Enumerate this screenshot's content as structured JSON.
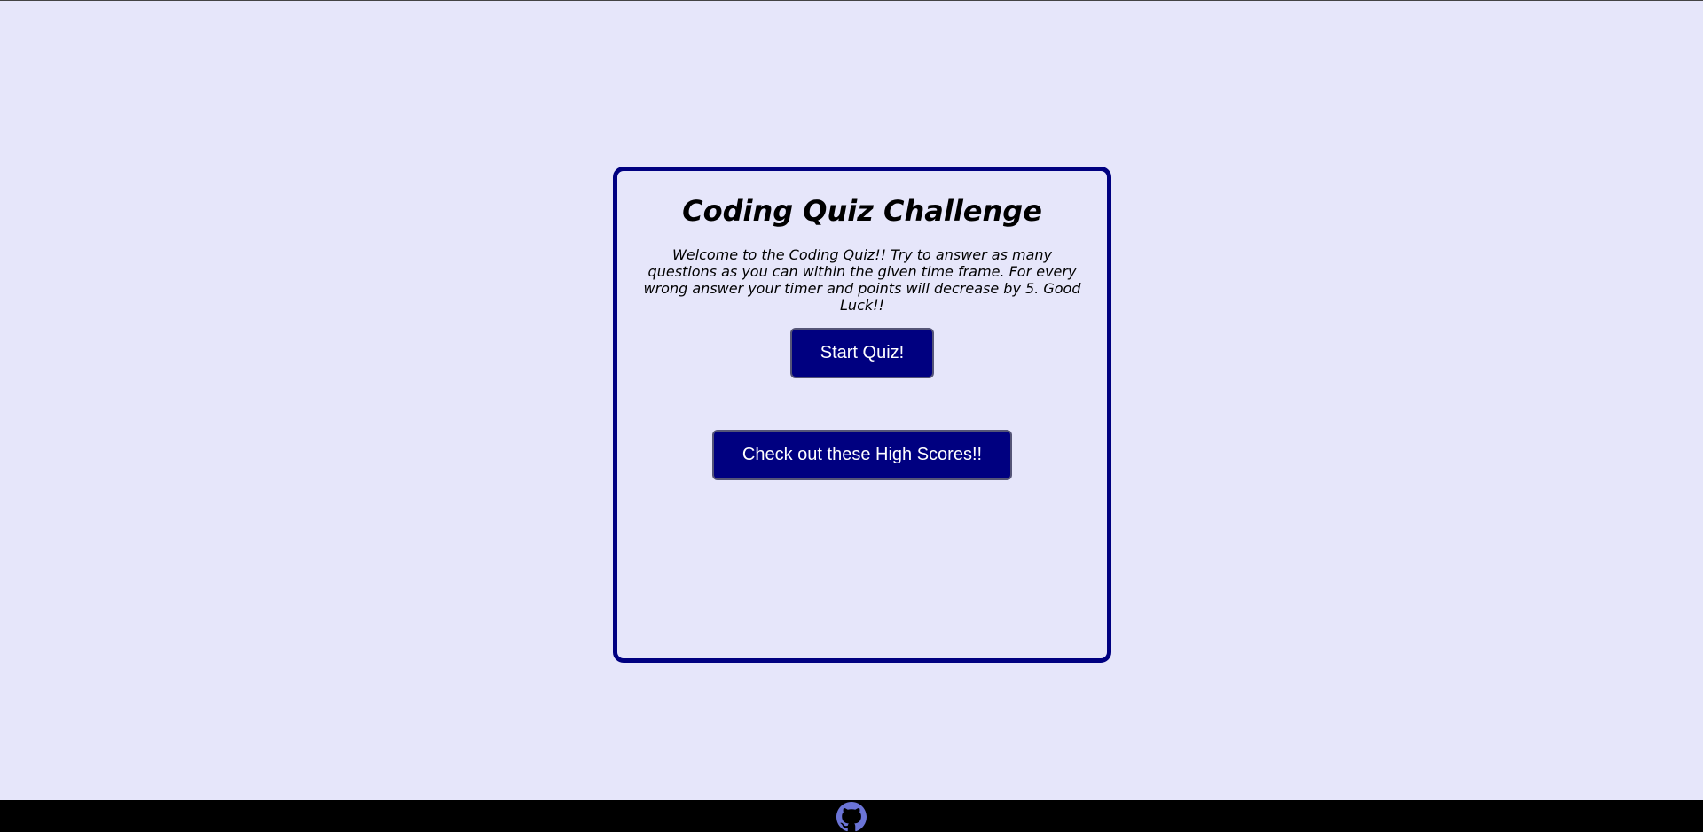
{
  "quiz": {
    "title": "Coding Quiz Challenge",
    "intro": "Welcome to the Coding Quiz!! Try to answer as many questions as you can within the given time frame. For every wrong answer your timer and points will decrease by 5. Good Luck!!",
    "start_label": "Start Quiz!",
    "scores_label": "Check out these High Scores!!"
  },
  "footer": {
    "icon": "github-icon"
  },
  "colors": {
    "page_background": "#e6e6fa",
    "accent": "#000080",
    "footer_background": "#000000",
    "icon_color": "#6b74d6"
  }
}
